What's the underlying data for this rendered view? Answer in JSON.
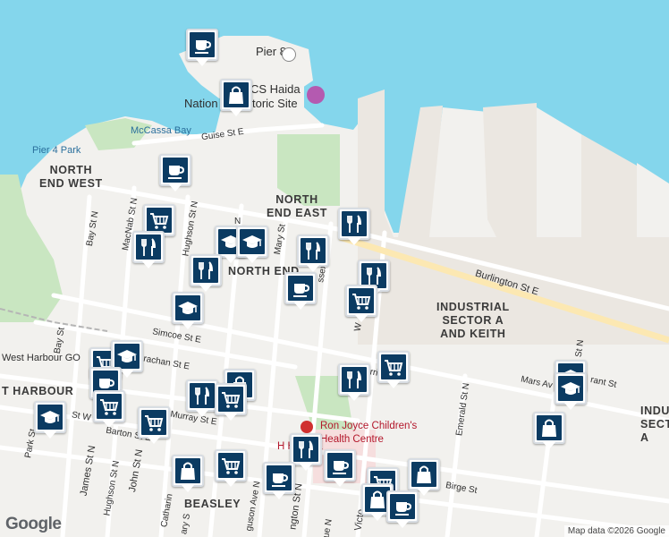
{
  "map": {
    "attribution": "Map data ©2026 Google",
    "logo_text": "Google"
  },
  "colors": {
    "water": "#84d6ec",
    "land": "#f2f1ee",
    "park": "#c9e6c1",
    "industrial": "#ebe7e1",
    "road": "#ffffff",
    "highway": "#f8c967",
    "marker_fill": "#0b3b62"
  },
  "area_labels": {
    "north_end_west": [
      "NORTH",
      "END WEST"
    ],
    "north_end_east": [
      "NORTH",
      "END EAST"
    ],
    "north_end": "NORTH END",
    "industrial": [
      "INDUSTRIAL",
      "SECTOR A",
      "AND KEITH"
    ],
    "west_harbour": "T HARBOUR",
    "beasley": "BEASLEY",
    "indu_right": [
      "INDU",
      "SECT",
      "A"
    ]
  },
  "place_labels": {
    "pier8": "Pier 8",
    "pier4": "Pier 4 Park",
    "mccassa": "McCassa Bay",
    "haida_a": "CS Haida",
    "haida_b": "Nation",
    "haida_c": "toric Site",
    "ron_joyce_a": "Ron Joyce Children's",
    "ron_joyce_b": "Health Centre",
    "hospital": "H   Hospita",
    "west_harbour_go": "West Harbour GO"
  },
  "street_labels": {
    "guise": "Guise St E",
    "burlington": "Burlington St E",
    "simcoe": "Simcoe St E",
    "strachan": "rachan St E",
    "murray": "Murray St E",
    "barton": "Barton St E",
    "barton_w": "St W",
    "mars": "Mars Av",
    "grant": "rant St",
    "birge": "Birge St",
    "bay_n": "Bay St N",
    "bay_s": "Bay St",
    "macnab": "MacNab St N",
    "hughson": "Hughson St N",
    "hughson2": "Hughson St N",
    "mary": "Mary St",
    "james": "James St N",
    "john": "John St N",
    "park": "Park St",
    "emerald": "Emerald St N",
    "wellington": "ngton St N",
    "victoria": "Victo",
    "catharine": "Catharin",
    "ferguson": "guson Ave N",
    "ary": "ary S",
    "hess_b": "ue N",
    "wentworth": "W",
    "sherman_n": "h St N",
    "ferrie": "Ferri",
    "n_small": "N",
    "ssex": "ssex"
  },
  "markers": [
    {
      "type": "coffee-icon"
    },
    {
      "type": "shopping-bag-icon"
    },
    {
      "type": "coffee-icon"
    },
    {
      "type": "shopping-cart-icon"
    },
    {
      "type": "cutlery-icon"
    },
    {
      "type": "school-icon"
    },
    {
      "type": "school-icon"
    },
    {
      "type": "cutlery-icon"
    },
    {
      "type": "cutlery-icon"
    },
    {
      "type": "cutlery-icon"
    },
    {
      "type": "coffee-icon"
    },
    {
      "type": "cutlery-icon"
    },
    {
      "type": "shopping-cart-icon"
    },
    {
      "type": "school-icon"
    },
    {
      "type": "shopping-cart-icon"
    },
    {
      "type": "school-icon"
    },
    {
      "type": "coffee-icon"
    },
    {
      "type": "shopping-cart-icon"
    },
    {
      "type": "school-icon"
    },
    {
      "type": "cutlery-icon"
    },
    {
      "type": "shopping-bag-icon"
    },
    {
      "type": "shopping-cart-icon"
    },
    {
      "type": "cutlery-icon"
    },
    {
      "type": "shopping-cart-icon"
    },
    {
      "type": "shopping-cart-icon"
    },
    {
      "type": "school-icon"
    },
    {
      "type": "school-icon"
    },
    {
      "type": "shopping-bag-icon"
    },
    {
      "type": "cutlery-icon"
    },
    {
      "type": "coffee-icon"
    },
    {
      "type": "shopping-bag-icon"
    },
    {
      "type": "shopping-cart-icon"
    },
    {
      "type": "coffee-icon"
    },
    {
      "type": "shopping-cart-icon"
    },
    {
      "type": "shopping-bag-icon"
    },
    {
      "type": "shopping-bag-icon"
    },
    {
      "type": "coffee-icon"
    }
  ]
}
